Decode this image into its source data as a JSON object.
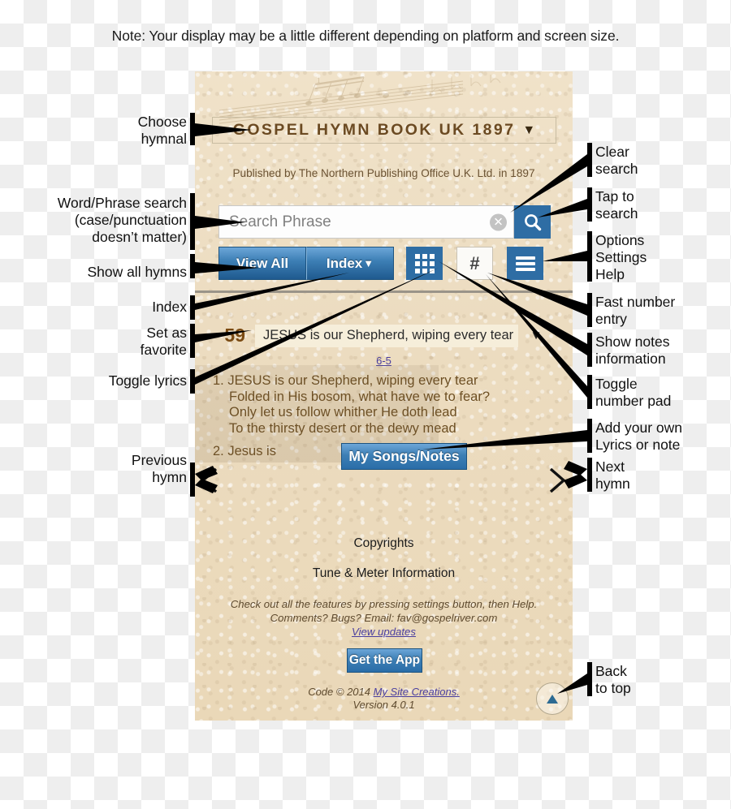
{
  "note": "Note: Your display may be a little different depending on platform and screen size.",
  "app": {
    "hymnal": {
      "title": "GOSPEL HYMN BOOK UK 1897",
      "caret": "▼"
    },
    "publisher": "Published by The Northern Publishing Office U.K. Ltd. in 1897",
    "search": {
      "placeholder": "Search Phrase",
      "value": "",
      "clear_glyph": "✕",
      "search_icon": "search-icon"
    },
    "toolbar": {
      "view_all_label": "View All",
      "index_label": "Index",
      "index_caret": "▼",
      "grid_icon": "grid-icon",
      "hash_label": "#",
      "menu_icon": "hamburger-icon"
    },
    "hymn": {
      "number": "59",
      "title": "JESUS is our Shepherd, wiping every tear",
      "expand_caret": "▼",
      "meter": "6-5",
      "verses": [
        {
          "number": "1.",
          "lines": [
            "JESUS is our Shepherd, wiping every tear",
            "Folded in His bosom, what have we to fear?",
            "Only let us follow whither He doth lead",
            "To the thirsty desert or the dewy mead"
          ]
        },
        {
          "number": "2.",
          "lines": [
            "Jesus is"
          ]
        }
      ]
    },
    "my_songs_label": "My Songs/Notes",
    "footer": {
      "copyrights": "Copyrights",
      "tune_meter": "Tune & Meter Information",
      "help_line_1": "Check out all the features by pressing settings button, then Help.",
      "help_line_2": "Comments? Bugs? Email: fav@gospelriver.com",
      "view_updates": "View updates",
      "get_app_label": "Get the App",
      "code_line": "Code © 2014 ",
      "site_creations": "My Site Creations.",
      "version": "Version 4.0.1"
    },
    "back_to_top": "▲"
  },
  "annotations": {
    "left": [
      {
        "id": "choose-hymnal",
        "text": "Choose\nhymnal"
      },
      {
        "id": "word-phrase-search",
        "text": "Word/Phrase search\n(case/punctuation\ndoesn’t matter)"
      },
      {
        "id": "show-all-hymns",
        "text": "Show all hymns"
      },
      {
        "id": "index",
        "text": "Index"
      },
      {
        "id": "set-as-favorite",
        "text": "Set as\nfavorite"
      },
      {
        "id": "toggle-lyrics",
        "text": "Toggle lyrics"
      },
      {
        "id": "previous-hymn",
        "text": "Previous\nhymn"
      }
    ],
    "right": [
      {
        "id": "clear-search",
        "text": "Clear\nsearch"
      },
      {
        "id": "tap-to-search",
        "text": "Tap to\nsearch"
      },
      {
        "id": "options-settings-help",
        "text": "Options\nSettings\nHelp"
      },
      {
        "id": "fast-number-entry",
        "text": "Fast number\nentry"
      },
      {
        "id": "show-notes-information",
        "text": "Show notes\ninformation"
      },
      {
        "id": "toggle-number-pad",
        "text": "Toggle\nnumber pad"
      },
      {
        "id": "add-your-own",
        "text": "Add your own\nLyrics or note"
      },
      {
        "id": "next-hymn",
        "text": "Next\nhymn"
      },
      {
        "id": "back-to-top",
        "text": "Back\nto top"
      }
    ]
  },
  "colors": {
    "accent_blue": "#2e6da4",
    "paper": "#ead9bb",
    "hymn_brown": "#6d4f23",
    "link_purple": "#4a3fa0"
  }
}
